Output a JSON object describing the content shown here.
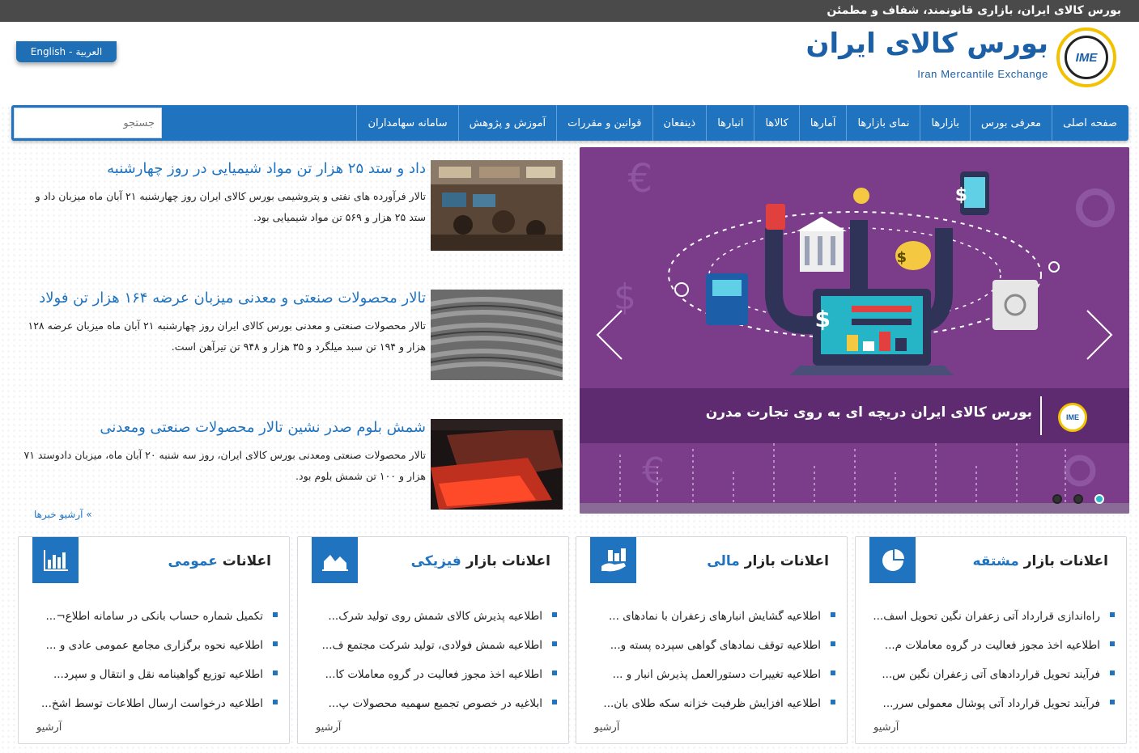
{
  "topbar": {
    "tagline": "بورس کالای ایران، بازاری قانونمند، شفاف و مطمئن"
  },
  "header": {
    "lang_arabic": "العربية",
    "lang_sep": "-",
    "lang_english": "English",
    "logo_fa": "بورس کالای ایران",
    "logo_en": "Iran Mercantile Exchange",
    "logo_mark": "IME"
  },
  "nav": {
    "items": [
      "صفحه اصلی",
      "معرفی بورس",
      "بازارها",
      "نمای بازارها",
      "آمارها",
      "کالاها",
      "انبارها",
      "ذینفعان",
      "قوانین و مقررات",
      "آموزش و پژوهش",
      "سامانه سهامداران"
    ],
    "search_placeholder": "جستجو"
  },
  "slider": {
    "caption": "بورس کالای ایران دریچه ای به روی تجارت مدرن",
    "caption_logo": "IME",
    "active_slide": 1,
    "slide_count": 3
  },
  "news": [
    {
      "title": "داد و ستد ۲۵ هزار تن مواد شیمیایی در روز چهارشنبه",
      "text": "تالار فرآورده های نفتی و پتروشیمی بورس کالای ایران روز چهارشنبه ۲۱ آبان ماه میزبان داد و ستد ۲۵ هزار و ۵۶۹ تن مواد شیمیایی بود."
    },
    {
      "title": "تالار محصولات صنعتی و معدنی میزبان عرضه ۱۶۴ هزار تن فولاد",
      "text": "تالار محصولات صنعتی و معدنی بورس کالای ایران روز چهارشنبه ۲۱ آبان ماه میزبان عرضه ۱۲۸ هزار و ۱۹۴ تن سبد میلگرد و ۳۵ هزار و ۹۴۸ تن تیرآهن است."
    },
    {
      "title": "شمش بلوم صدر نشین تالار محصولات صنعتی ومعدنی",
      "text": "تالار محصولات صنعتی ومعدنی بورس کالای ایران، روز سه شنبه ۲۰ آبان ماه، میزبان دادوستد ۷۱ هزار و ۱۰۰ تن شمش بلوم بود."
    }
  ],
  "news_archive": "» آرشیو خبرها",
  "announcements": [
    {
      "title_prefix": "اعلانات بازار",
      "title_accent": "مشتقه",
      "icon": "pie-chart-icon",
      "items": [
        "راه‌اندازی قرارداد آتی زعفران نگین تحویل اسف...",
        "اطلاعیه اخذ مجوز فعالیت در گروه معاملات م...",
        "فرآیند تحویل قراردادهای آتی زعفران نگین س...",
        "فرآیند تحویل قرارداد آتی پوشال معمولی سرر..."
      ],
      "archive": "آرشیو"
    },
    {
      "title_prefix": "اعلانات بازار",
      "title_accent": "مالی",
      "icon": "money-hand-icon",
      "items": [
        "اطلاعیه گشایش انبارهای زعفران با نمادهای ...",
        "اطلاعیه توقف نمادهای گواهی سپرده پسته و...",
        "اطلاعیه تغییرات دستورالعمل پذیرش انبار و ...",
        "اطلاعیه افزایش ظرفیت خزانه سکه طلای بان..."
      ],
      "archive": "آرشیو"
    },
    {
      "title_prefix": "اعلانات بازار",
      "title_accent": "فیزیکی",
      "icon": "area-chart-icon",
      "items": [
        "اطلاعیه پذیرش کالای شمش روی تولید شرک...",
        "اطلاعیه شمش فولادی، تولید شرکت مجتمع ف...",
        "اطلاعیه اخذ مجوز فعالیت در گروه معاملات کا...",
        "ابلاغیه در خصوص تجمیع سهمیه محصولات پ..."
      ],
      "archive": "آرشیو"
    },
    {
      "title_prefix": "اعلانات",
      "title_accent": "عمومی",
      "icon": "bar-chart-icon",
      "items": [
        "تکمیل شماره حساب بانکی در سامانه اطلاع¬...",
        "اطلاعیه نحوه برگزاری مجامع عمومی عادی و ...",
        "اطلاعیه توزیع گواهینامه نقل و انتقال و سپرد...",
        "اطلاعیه درخواست ارسال اطلاعات توسط اشخ..."
      ],
      "archive": "آرشیو"
    }
  ],
  "colors": {
    "brand_blue": "#1f73bf",
    "slider_purple": "#7b3d8a",
    "topbar": "#4a4a4a",
    "logo_yellow": "#f2c200"
  }
}
